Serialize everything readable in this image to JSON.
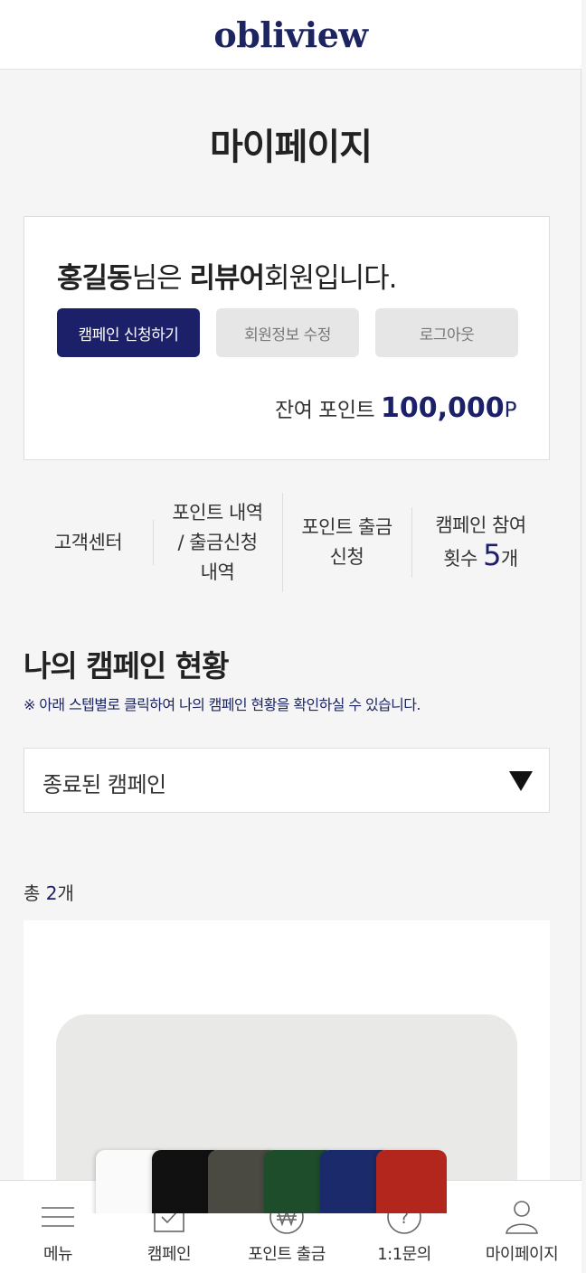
{
  "header": {
    "logo": "obliview"
  },
  "page_title": "마이페이지",
  "profile": {
    "name": "홍길동",
    "greeting_mid": "님은 ",
    "grade": "리뷰어",
    "greeting_end": "회원입니다.",
    "buttons": {
      "apply": "캠페인 신청하기",
      "edit": "회원정보 수정",
      "logout": "로그아웃"
    },
    "points_label": "잔여 포인트 ",
    "points_value": "100,000",
    "points_unit": "P"
  },
  "quick_menu": {
    "support": "고객센터",
    "history_line1": "포인트 내역",
    "history_line2": "/ 출금신청",
    "history_line3": "내역",
    "withdraw_line1": "포인트 출금",
    "withdraw_line2": "신청",
    "participation_line1": "캠페인 참여",
    "participation_prefix": "횟수 ",
    "participation_count": "5",
    "participation_suffix": "개"
  },
  "campaign_status": {
    "title": "나의 캠페인 현황",
    "note": "※ 아래 스텝별로 클릭하여 나의 캠페인 현황을 확인하실 수 있습니다.",
    "filter_selected": "종료된 캠페인",
    "total_prefix": "총 ",
    "total_count": "2",
    "total_suffix": "개"
  },
  "shirt_colors": [
    "#fafafa",
    "#111111",
    "#4a4a42",
    "#1e4d2b",
    "#1b2a6b",
    "#b3261e"
  ],
  "tabbar": {
    "menu": "메뉴",
    "campaign": "캠페인",
    "withdraw": "포인트 출금",
    "inquiry": "1:1문의",
    "mypage": "마이페이지"
  },
  "icons": {
    "menu": "hamburger-icon",
    "campaign": "calendar-check-icon",
    "withdraw": "won-coin-icon",
    "inquiry": "question-circle-icon",
    "mypage": "user-icon"
  }
}
